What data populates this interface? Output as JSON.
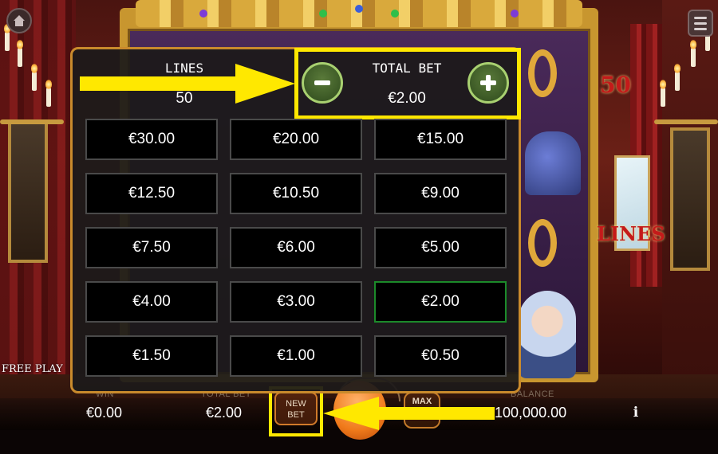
{
  "game": {
    "free_play_label": "FREE PLAY",
    "banner_number": "50",
    "banner_word": "LINES",
    "accent_color": "#c98a2c",
    "highlight_color": "#ffe800",
    "selected_color": "#1c8a2a"
  },
  "bet_panel": {
    "lines_label": "LINES",
    "lines_value": "50",
    "total_bet_label": "TOTAL BET",
    "total_bet_value": "€2.00",
    "minus_icon": "minus-icon",
    "plus_icon": "plus-icon",
    "selected_option": "€2.00",
    "options": [
      [
        "€30.00",
        "€20.00",
        "€15.00"
      ],
      [
        "€12.50",
        "€10.50",
        "€9.00"
      ],
      [
        "€7.50",
        "€6.00",
        "€5.00"
      ],
      [
        "€4.00",
        "€3.00",
        "€2.00"
      ],
      [
        "€1.50",
        "€1.00",
        "€0.50"
      ]
    ]
  },
  "bottom_bar": {
    "win_label": "WIN",
    "win_value": "€0.00",
    "total_bet_label": "TOTAL BET",
    "total_bet_value": "€2.00",
    "new_bet_line1": "NEW",
    "new_bet_line2": "BET",
    "max_label": "MAX",
    "balance_label": "BALANCE",
    "balance_value": "€100,000.00",
    "info_label": "i"
  }
}
